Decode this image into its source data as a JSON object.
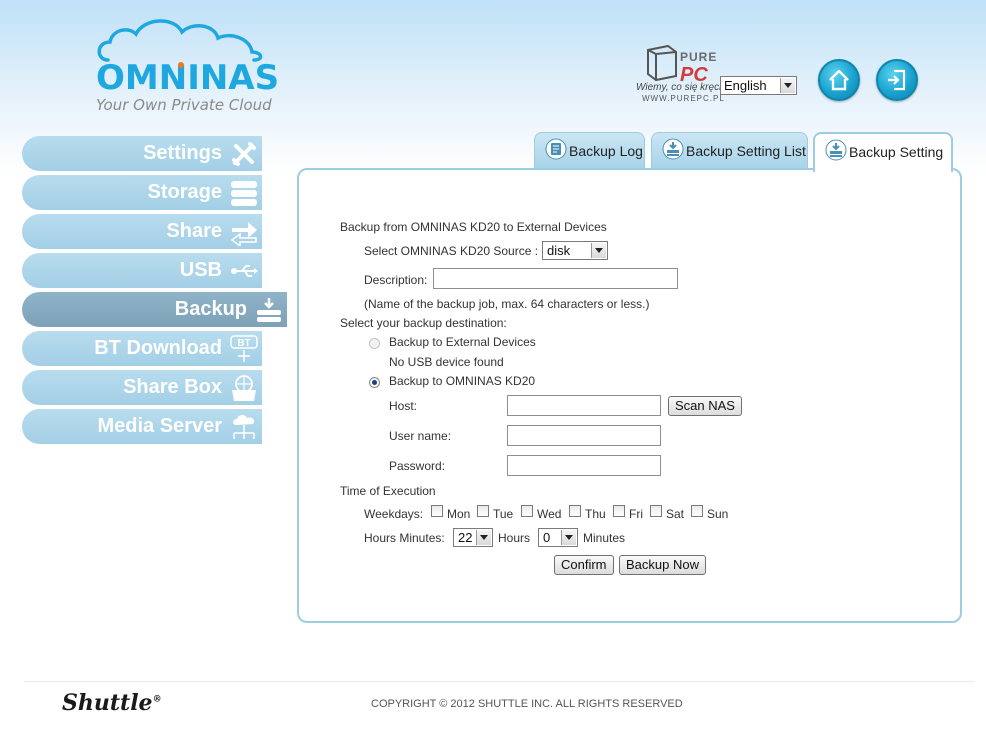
{
  "header": {
    "brand": "OMNINAS",
    "tagline": "Your Own Private Cloud",
    "watermark": {
      "name": "PURE",
      "brand": "PC",
      "slogan": "Wiemy, co się kręci",
      "site": "WWW.PUREPC.PL"
    },
    "language": "English"
  },
  "sidebar": {
    "items": [
      {
        "label": "Settings",
        "icon": "tools-icon"
      },
      {
        "label": "Storage",
        "icon": "storage-icon"
      },
      {
        "label": "Share",
        "icon": "share-arrows-icon"
      },
      {
        "label": "USB",
        "icon": "usb-icon"
      },
      {
        "label": "Backup",
        "icon": "backup-icon",
        "active": true
      },
      {
        "label": "BT Download",
        "icon": "bt-download-icon",
        "badge": "BT"
      },
      {
        "label": "Share Box",
        "icon": "share-box-icon"
      },
      {
        "label": "Media Server",
        "icon": "media-server-icon"
      }
    ]
  },
  "tabs": [
    {
      "label": "Backup Log"
    },
    {
      "label": "Backup Setting List"
    },
    {
      "label": "Backup Setting",
      "active": true
    }
  ],
  "form": {
    "section_title": "Backup from OMNINAS KD20 to External Devices",
    "source_label": "Select OMNINAS KD20 Source :",
    "source_value": "disk",
    "description_label": "Description:",
    "description_value": "",
    "description_hint": "(Name of the backup job, max. 64 characters or less.)",
    "destination_title": "Select your backup destination:",
    "option_external": "Backup to External Devices",
    "no_usb": "No USB device found",
    "option_nas": "Backup to OMNINAS KD20",
    "host_label": "Host:",
    "host_value": "",
    "scan_button": "Scan NAS",
    "username_label": "User name:",
    "username_value": "",
    "password_label": "Password:",
    "password_value": "",
    "time_title": "Time of Execution",
    "weekdays_label": "Weekdays:",
    "weekdays": [
      "Mon",
      "Tue",
      "Wed",
      "Thu",
      "Fri",
      "Sat",
      "Sun"
    ],
    "hours_minutes_label": "Hours Minutes:",
    "hours_value": "22",
    "hours_label": "Hours",
    "minutes_value": "0",
    "minutes_label": "Minutes",
    "confirm_button": "Confirm",
    "backup_now_button": "Backup Now"
  },
  "footer": {
    "logo": "Shuttle",
    "trademark": "®",
    "copyright": "COPYRIGHT © 2012 SHUTTLE INC. ALL RIGHTS RESERVED"
  },
  "colors": {
    "accent": "#1fa7e0",
    "nav": "#a3cfe6",
    "nav_active": "#7da2b8",
    "panel_border": "#9ccde2"
  }
}
